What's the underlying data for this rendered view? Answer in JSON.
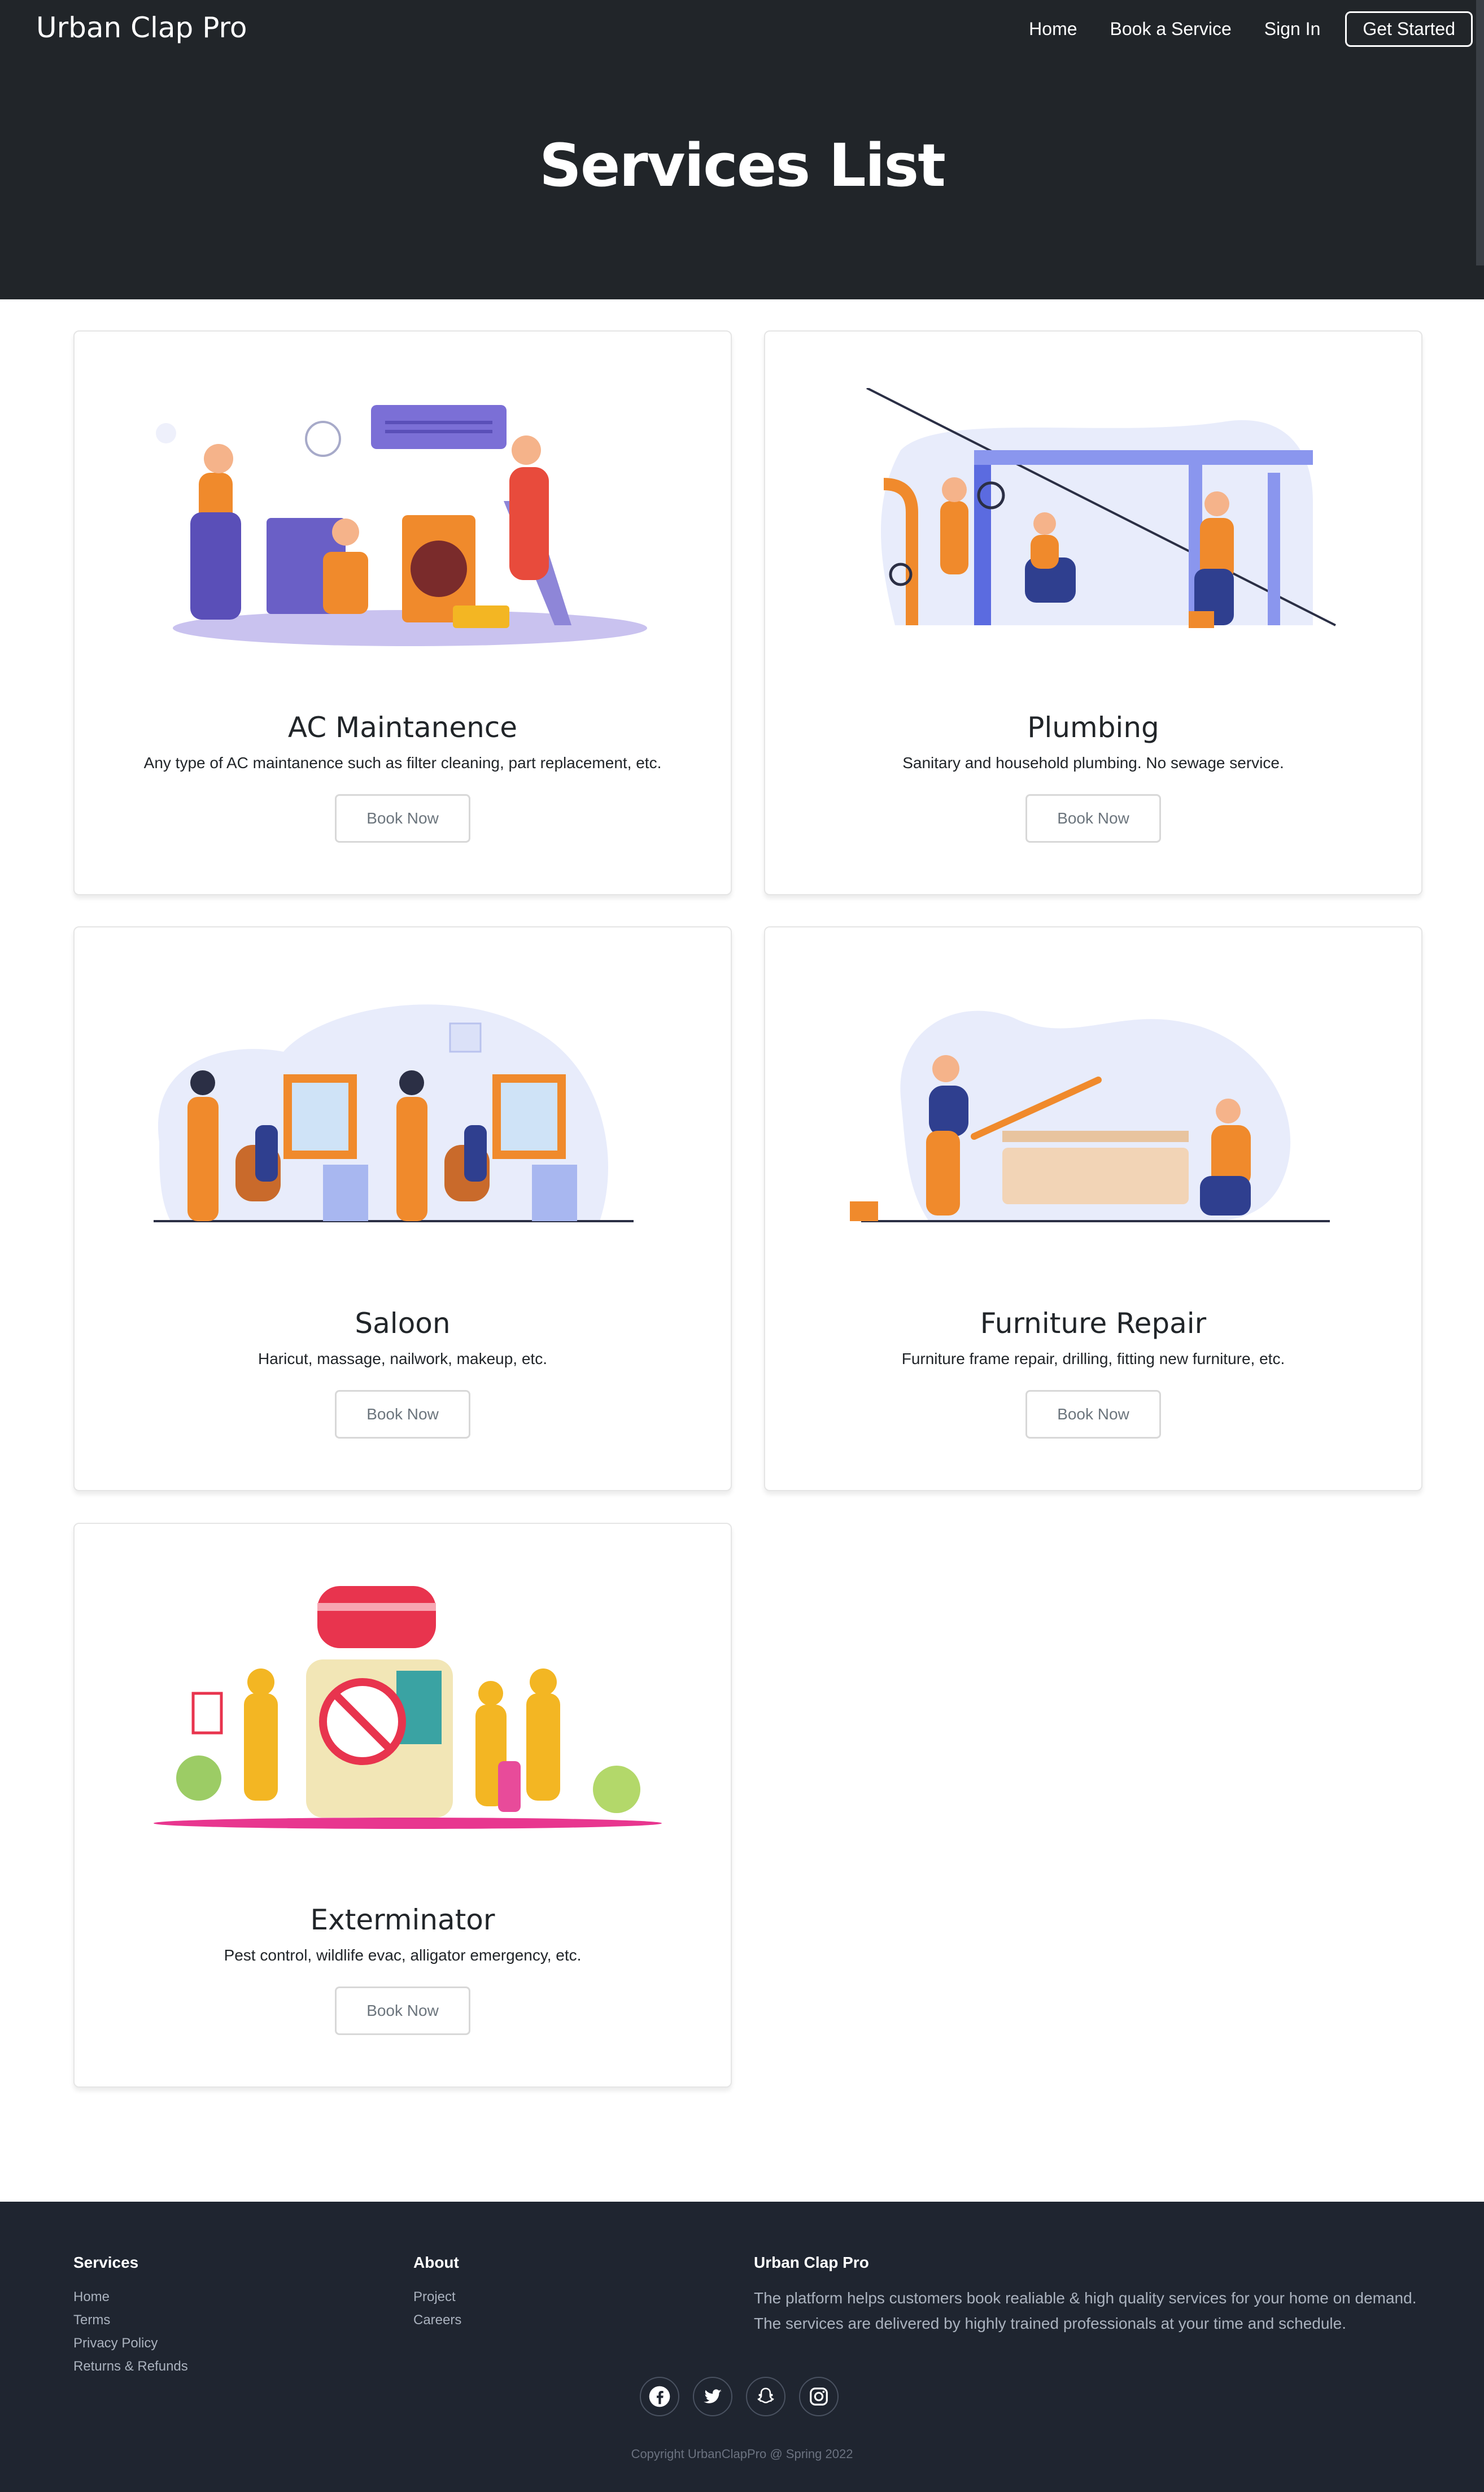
{
  "nav": {
    "brand": "Urban Clap Pro",
    "links": [
      "Home",
      "Book a Service",
      "Sign In"
    ],
    "cta": "Get Started"
  },
  "hero": {
    "title": "Services List"
  },
  "services": [
    {
      "title": "AC Maintanence",
      "description": "Any type of AC maintanence such as filter cleaning, part replacement, etc.",
      "button": "Book Now",
      "icon": "ac-maintenance-illustration"
    },
    {
      "title": "Plumbing",
      "description": "Sanitary and household plumbing. No sewage service.",
      "button": "Book Now",
      "icon": "plumbing-illustration"
    },
    {
      "title": "Saloon",
      "description": "Haricut, massage, nailwork, makeup, etc.",
      "button": "Book Now",
      "icon": "saloon-illustration"
    },
    {
      "title": "Furniture Repair",
      "description": "Furniture frame repair, drilling, fitting new furniture, etc.",
      "button": "Book Now",
      "icon": "furniture-repair-illustration"
    },
    {
      "title": "Exterminator",
      "description": "Pest control, wildlife evac, alligator emergency, etc.",
      "button": "Book Now",
      "icon": "exterminator-illustration"
    }
  ],
  "footer": {
    "services": {
      "heading": "Services",
      "links": [
        "Home",
        "Terms",
        "Privacy Policy",
        "Returns & Refunds"
      ]
    },
    "about": {
      "heading": "About",
      "links": [
        "Project",
        "Careers"
      ]
    },
    "company": {
      "heading": "Urban Clap Pro",
      "text_line1": "The platform helps customers book realiable & high quality services for your home on demand.",
      "text_line2": "The services are delivered by highly trained professionals at your time and schedule."
    },
    "socials": [
      "facebook-icon",
      "twitter-icon",
      "snapchat-icon",
      "instagram-icon"
    ],
    "copyright": "Copyright UrbanClapPro @ Spring 2022"
  },
  "colors": {
    "dark": "#212529",
    "footer": "#1f2530",
    "accent_orange": "#f08a2c",
    "accent_navy": "#2f3f8f",
    "accent_purple": "#7b6fd6"
  }
}
